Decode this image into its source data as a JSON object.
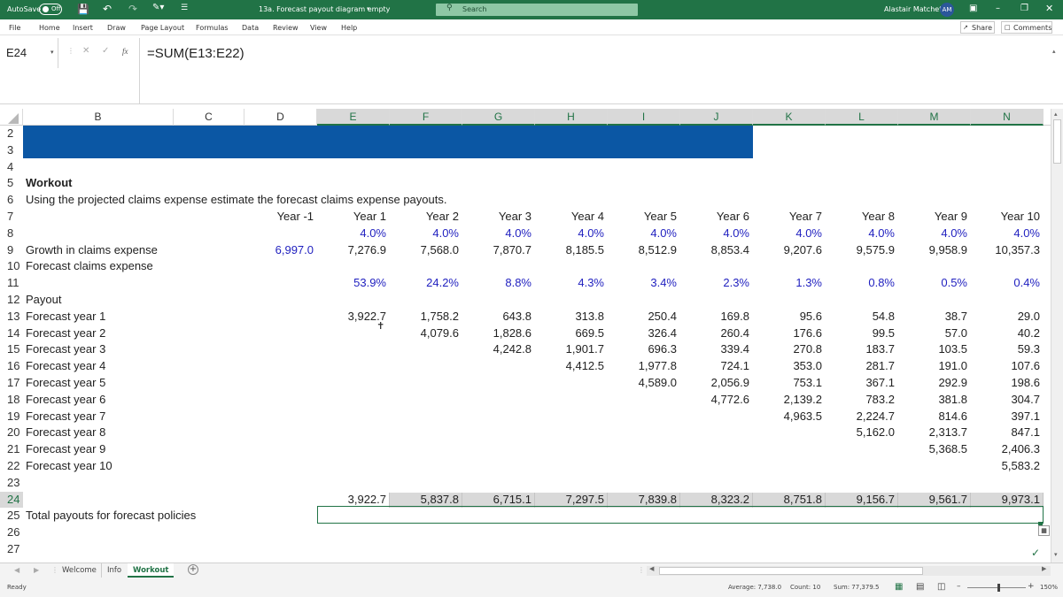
{
  "titlebar": {
    "autosave_label": "AutoSave",
    "autosave_state": "Off",
    "doc_title": "13a. Forecast payout diagram empty",
    "search_placeholder": "Search",
    "user_name": "Alastair Matchett",
    "user_initials": "AM"
  },
  "ribbon": {
    "tabs": [
      "File",
      "Home",
      "Insert",
      "Draw",
      "Page Layout",
      "Formulas",
      "Data",
      "Review",
      "View",
      "Help"
    ],
    "share_label": "Share",
    "comments_label": "Comments"
  },
  "formula_bar": {
    "name_box": "E24",
    "fx_label": "fx",
    "formula": "=SUM(E13:E22)"
  },
  "columns": [
    "B",
    "C",
    "D",
    "E",
    "F",
    "G",
    "H",
    "I",
    "J",
    "K",
    "L",
    "M",
    "N"
  ],
  "rows": [
    "2",
    "3",
    "4",
    "5",
    "6",
    "7",
    "8",
    "9",
    "10",
    "11",
    "12",
    "13",
    "14",
    "15",
    "16",
    "17",
    "18",
    "19",
    "20",
    "21",
    "22",
    "23",
    "24",
    "25",
    "26",
    "27"
  ],
  "sheet": {
    "section_title": "Workout",
    "instruction": "Using the projected claims expense estimate the forecast claims expense payouts.",
    "year_headers": [
      "Year -1",
      "Year 1",
      "Year 2",
      "Year 3",
      "Year 4",
      "Year 5",
      "Year 6",
      "Year 7",
      "Year 8",
      "Year 9",
      "Year 10"
    ],
    "growth_label": "Growth in claims expense",
    "growth": [
      "4.0%",
      "4.0%",
      "4.0%",
      "4.0%",
      "4.0%",
      "4.0%",
      "4.0%",
      "4.0%",
      "4.0%",
      "4.0%"
    ],
    "forecast_label": "Forecast claims expense",
    "forecast": [
      "6,997.0",
      "7,276.9",
      "7,568.0",
      "7,870.7",
      "8,185.5",
      "8,512.9",
      "8,853.4",
      "9,207.6",
      "9,575.9",
      "9,958.9",
      "10,357.3"
    ],
    "payout_label": "Payout",
    "payout": [
      "53.9%",
      "24.2%",
      "8.8%",
      "4.3%",
      "3.4%",
      "2.3%",
      "1.3%",
      "0.8%",
      "0.5%",
      "0.4%"
    ],
    "fy_labels": [
      "Forecast year 1",
      "Forecast year 2",
      "Forecast year 3",
      "Forecast year 4",
      "Forecast year 5",
      "Forecast year 6",
      "Forecast year 7",
      "Forecast year 8",
      "Forecast year 9",
      "Forecast year 10"
    ],
    "fy_values": [
      [
        "3,922.7",
        "1,758.2",
        "643.8",
        "313.8",
        "250.4",
        "169.8",
        "95.6",
        "54.8",
        "38.7",
        "29.0"
      ],
      [
        "4,079.6",
        "1,828.6",
        "669.5",
        "326.4",
        "260.4",
        "176.6",
        "99.5",
        "57.0",
        "40.2"
      ],
      [
        "4,242.8",
        "1,901.7",
        "696.3",
        "339.4",
        "270.8",
        "183.7",
        "103.5",
        "59.3"
      ],
      [
        "4,412.5",
        "1,977.8",
        "724.1",
        "353.0",
        "281.7",
        "191.0",
        "107.6"
      ],
      [
        "4,589.0",
        "2,056.9",
        "753.1",
        "367.1",
        "292.9",
        "198.6"
      ],
      [
        "4,772.6",
        "2,139.2",
        "783.2",
        "381.8",
        "304.7"
      ],
      [
        "4,963.5",
        "2,224.7",
        "814.6",
        "397.1"
      ],
      [
        "5,162.0",
        "2,313.7",
        "847.1"
      ],
      [
        "5,368.5",
        "2,406.3"
      ],
      [
        "5,583.2"
      ]
    ],
    "total_label": "Total payouts for forecast policies",
    "totals": [
      "3,922.7",
      "5,837.8",
      "6,715.1",
      "7,297.5",
      "7,839.8",
      "8,323.2",
      "8,751.8",
      "9,156.7",
      "9,561.7",
      "9,973.1"
    ]
  },
  "sheet_tabs": [
    "Welcome",
    "Info",
    "Workout"
  ],
  "active_tab": "Workout",
  "status": {
    "ready": "Ready",
    "average": "Average: 7,738.0",
    "count": "Count: 10",
    "sum": "Sum: 77,379.5",
    "zoom": "150%"
  },
  "colors": {
    "excel_green": "#217346",
    "banner_blue": "#0b57a4",
    "input_blue": "#1f1fbf"
  }
}
